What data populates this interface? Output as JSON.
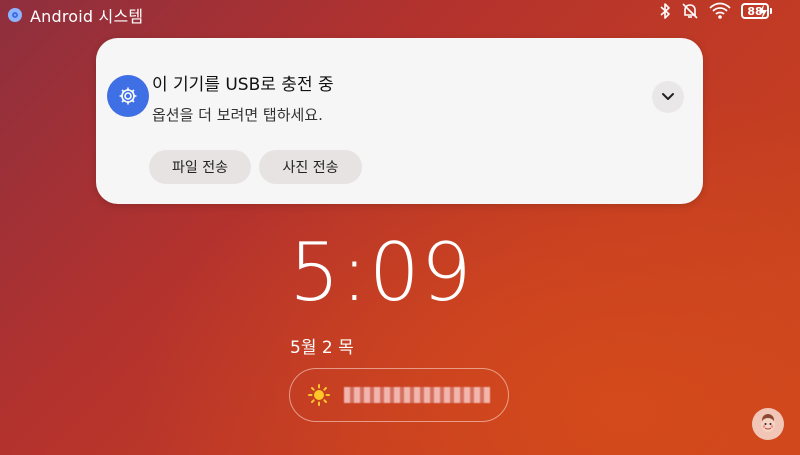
{
  "status_bar": {
    "app_name": "Android 시스템",
    "battery_level": "88",
    "icons": [
      "bluetooth-icon",
      "bell-off-icon",
      "wifi-icon",
      "battery-icon",
      "charging-bolt-icon"
    ]
  },
  "notification": {
    "icon": "settings-gear-icon",
    "title": "이 기기를 USB로 충전 중",
    "text": "옵션을 더 보려면 탭하세요.",
    "actions": [
      "파일 전송",
      "사진 전송"
    ]
  },
  "lock_screen": {
    "time": "5:09",
    "date": "5월 2 목",
    "weather_icon": "sun-icon"
  },
  "colors": {
    "notification_bg": "#f7f6f6",
    "notification_icon_bg": "#3f6fe5",
    "button_bg": "#e7e3e3"
  }
}
